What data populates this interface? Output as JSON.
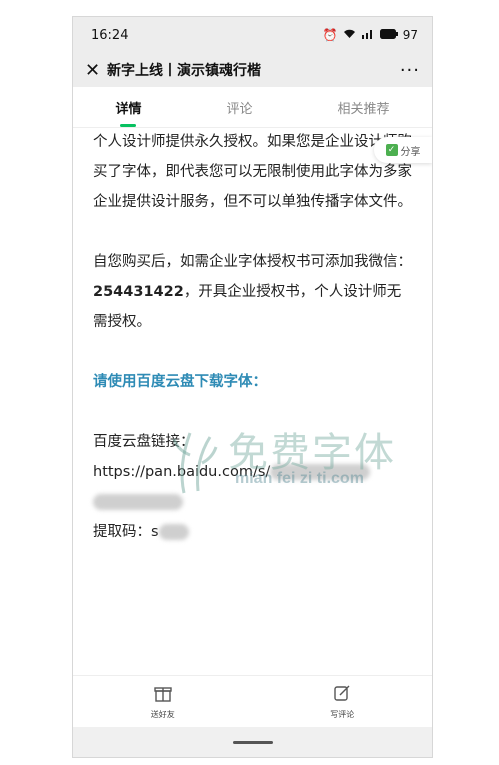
{
  "status": {
    "time": "16:24",
    "battery": "97"
  },
  "header": {
    "title": "新字上线丨演示镇魂行楷",
    "more": "···"
  },
  "tabs": [
    {
      "label": "详情"
    },
    {
      "label": "评论"
    },
    {
      "label": "相关推荐"
    }
  ],
  "article": {
    "p1": "个人设计师提供永久授权。如果您是企业设计师购买了字体，即代表您可以无限制使用此字体为多家企业提供设计服务，但不可以单独传播字体文件。",
    "p2a": "自您购买后，如需企业字体授权书可添加我微信：",
    "wechat": "254431422",
    "p2b": "，开具企业授权书，个人设计师无需授权。",
    "heading": "请使用百度云盘下载字体：",
    "link_label": "百度云盘链接：",
    "link_prefix": "https://pan.baidu.com/s/",
    "code_label": "提取码：s"
  },
  "share": {
    "label": "分享"
  },
  "watermark": {
    "cn": "免费字体",
    "en": "mian fei zi ti.com"
  },
  "bottom": {
    "gift_label": "送好友",
    "comment_label": "写评论"
  }
}
